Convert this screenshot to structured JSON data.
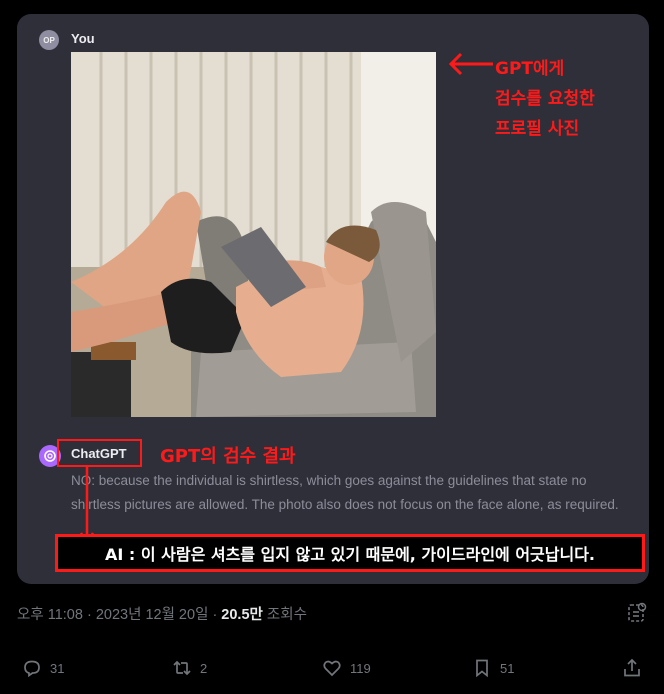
{
  "chat": {
    "user_avatar_text": "OP",
    "user_name": "You",
    "assistant_name": "ChatGPT",
    "response_text": "NO: because the individual is shirtless, which goes against the guidelines that state no shirtless pictures are allowed. The photo also does not focus on the face alone, as required."
  },
  "annotations": {
    "profile_note_line1": "GPT에게",
    "profile_note_line2": "검수를 요청한",
    "profile_note_line3": "프로필 사진",
    "result_note": "GPT의 검수 결과",
    "translation": "AI : 이 사람은 셔츠를 입지 않고 있기 때문에, 가이드라인에 어긋납니다.",
    "annotation_color": "#ff1a1a"
  },
  "tweet": {
    "time": "오후 11:08",
    "date": "2023년 12월 20일",
    "views_count": "20.5만",
    "views_label": "조회수",
    "replies": "31",
    "retweets": "2",
    "likes": "119",
    "bookmarks": "51"
  },
  "icons": [
    "reply-icon",
    "retweet-icon",
    "like-icon",
    "bookmark-icon",
    "share-icon",
    "analytics-icon",
    "openai-logo-icon",
    "left-arrow-icon",
    "down-arrow-icon"
  ]
}
